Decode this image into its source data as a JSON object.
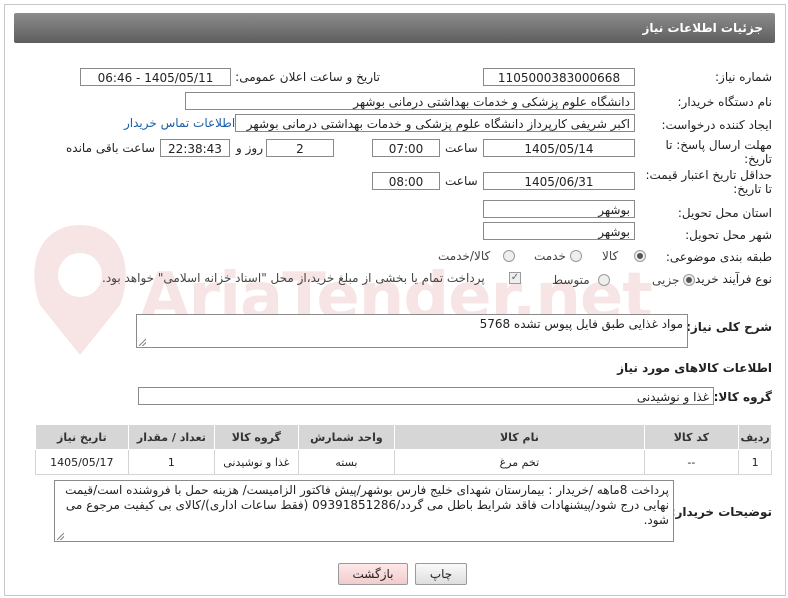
{
  "header": {
    "title": "جزئیات اطلاعات نیاز"
  },
  "fields": {
    "need_number_label": "شماره نیاز:",
    "need_number": "1105000383000668",
    "announce_label": "تاریخ و ساعت اعلان عمومی:",
    "announce_value": "1405/05/11 - 06:46",
    "buyer_org_label": "نام دستگاه خریدار:",
    "buyer_org": "دانشگاه علوم پزشکی و خدمات بهداشتی درمانی بوشهر",
    "creator_label": "ایجاد کننده درخواست:",
    "creator": "اکبر شریفی کارپرداز دانشگاه علوم پزشکی و خدمات بهداشتی درمانی بوشهر",
    "contact_link": "اطلاعات تماس خریدار",
    "reply_deadline_label_1": "مهلت ارسال پاسخ: تا",
    "reply_deadline_label_2": "تاریخ:",
    "reply_date": "1405/05/14",
    "time_label": "ساعت",
    "reply_time": "07:00",
    "days_value": "2",
    "days_label": "روز و",
    "remaining_time": "22:38:43",
    "remaining_label": "ساعت باقی مانده",
    "min_price_label_1": "حداقل تاریخ اعتبار قیمت:",
    "min_price_label_2": "تا تاریخ:",
    "min_price_date": "1405/06/31",
    "min_price_time": "08:00",
    "province_label": "استان محل تحویل:",
    "province": "بوشهر",
    "city_label": "شهر محل تحویل:",
    "city": "بوشهر",
    "category_label": "طبقه بندی موضوعی:",
    "category_options": [
      "کالا",
      "خدمت",
      "کالا/خدمت"
    ],
    "process_label": "نوع فرآیند خرید :",
    "process_options": [
      "جزیی",
      "متوسط"
    ],
    "payment_note": "پرداخت تمام یا بخشی از مبلغ خرید،از محل \"اسناد خزانه اسلامی\" خواهد بود.",
    "summary_label": "شرح کلی نیاز:",
    "summary": "مواد غذایی طبق فایل پیوس تشده 5768",
    "goods_info_title": "اطلاعات کالاهای مورد نیاز",
    "goods_group_label": "گروه کالا:",
    "goods_group": "غذا و نوشیدنی",
    "buyer_notes_label": "توضیحات خریدار:",
    "buyer_notes": "پرداخت 8ماهه /خریدار : بیمارستان شهدای خلیج فارس بوشهر/پیش فاکتور الزامیست/ هزینه حمل با فروشنده است/قیمت نهایی درج شود/پیشنهادات فاقد شرایط باطل می گردد/09391851286 (فقط ساعات اداری)/کالای بی کیفیت مرجوع می شود."
  },
  "table": {
    "headers": [
      "ردیف",
      "کد کالا",
      "نام کالا",
      "واحد شمارش",
      "گروه کالا",
      "تعداد / مقدار",
      "تاریخ نیاز"
    ],
    "rows": [
      [
        "1",
        "--",
        "تخم مرغ",
        "بسته",
        "غذا و نوشیدنی",
        "1",
        "1405/05/17"
      ]
    ]
  },
  "buttons": {
    "print": "چاپ",
    "back": "بازگشت"
  },
  "watermark": "AriaTender.net",
  "colors": {
    "header_bg": "#6e6e6e",
    "link": "#1a5ea8",
    "back_btn_bg": "#f7d7d7"
  }
}
